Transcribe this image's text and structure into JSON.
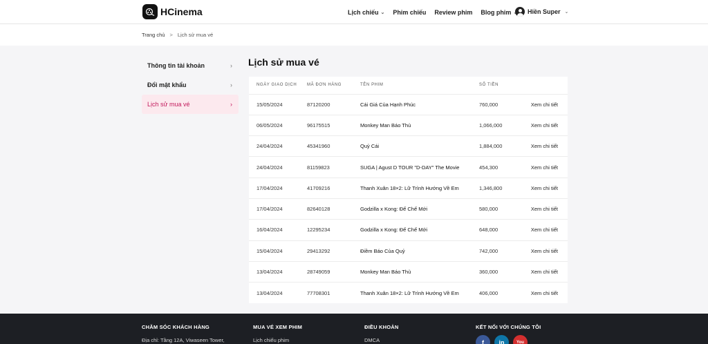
{
  "brand": {
    "name": "HCinema"
  },
  "nav": {
    "items": [
      {
        "label": "Lịch chiếu",
        "has_dropdown": true
      },
      {
        "label": "Phim chiếu",
        "has_dropdown": false
      },
      {
        "label": "Review phim",
        "has_dropdown": false
      },
      {
        "label": "Blog phim",
        "has_dropdown": true
      }
    ],
    "user_name": "Hiền Super"
  },
  "breadcrumb": {
    "home": "Trang chủ",
    "separator": ">",
    "current": "Lịch sử mua vé"
  },
  "sidebar": {
    "items": [
      {
        "label": "Thông tin tài khoản",
        "active": false
      },
      {
        "label": "Đổi mật khẩu",
        "active": false
      },
      {
        "label": "Lịch sử mua vé",
        "active": true
      }
    ]
  },
  "main": {
    "title": "Lịch sử mua vé",
    "columns": {
      "date": "NGÀY GIAO DỊCH",
      "order": "MÃ ĐƠN HÀNG",
      "film": "TÊN PHIM",
      "amount": "SỐ TIỀN"
    },
    "rows": [
      {
        "date": "15/05/2024",
        "order": "87120200",
        "film": "Cái Giá Của Hạnh Phúc",
        "amount": "760,000",
        "action": "Xem chi tiết"
      },
      {
        "date": "06/05/2024",
        "order": "96175515",
        "film": "Monkey Man Báo Thù",
        "amount": "1,066,000",
        "action": "Xem chi tiết"
      },
      {
        "date": "24/04/2024",
        "order": "45341960",
        "film": "Quỷ Cái",
        "amount": "1,884,000",
        "action": "Xem chi tiết"
      },
      {
        "date": "24/04/2024",
        "order": "81159823",
        "film": "SUGA | Agust D TOUR \"D-DAY\" The Movie",
        "amount": "454,300",
        "action": "Xem chi tiết"
      },
      {
        "date": "17/04/2024",
        "order": "41709216",
        "film": "Thanh Xuân 18×2: Lữ Trình Hướng Về Em",
        "amount": "1,346,800",
        "action": "Xem chi tiết"
      },
      {
        "date": "17/04/2024",
        "order": "82640128",
        "film": "Godzilla x Kong: Đế Chế Mới",
        "amount": "580,000",
        "action": "Xem chi tiết"
      },
      {
        "date": "16/04/2024",
        "order": "12295234",
        "film": "Godzilla x Kong: Đế Chế Mới",
        "amount": "648,000",
        "action": "Xem chi tiết"
      },
      {
        "date": "15/04/2024",
        "order": "29413292",
        "film": "Điềm Báo Của Quỷ",
        "amount": "742,000",
        "action": "Xem chi tiết"
      },
      {
        "date": "13/04/2024",
        "order": "28749059",
        "film": "Monkey Man Báo Thù",
        "amount": "360,000",
        "action": "Xem chi tiết"
      },
      {
        "date": "13/04/2024",
        "order": "77708301",
        "film": "Thanh Xuân 18×2: Lữ Trình Hướng Về Em",
        "amount": "406,000",
        "action": "Xem chi tiết"
      }
    ]
  },
  "footer": {
    "care": {
      "heading": "CHĂM SÓC KHÁCH HÀNG",
      "line": "Địa chỉ: Tầng 12A, Viwaseen Tower,"
    },
    "tickets": {
      "heading": "MUA VÉ XEM PHIM",
      "line": "Lịch chiếu phim"
    },
    "terms": {
      "heading": "ĐIỀU KHOẢN",
      "line": "DMCA"
    },
    "connect": {
      "heading": "KẾT NỐI VỚI CHÚNG TÔI",
      "socials": [
        {
          "icon": "facebook-icon",
          "glyph": "f",
          "color": "#3b5998"
        },
        {
          "icon": "linkedin-icon",
          "glyph": "in",
          "color": "#0e76a8"
        },
        {
          "icon": "youtube-icon",
          "glyph": "You",
          "color": "#d32f2f"
        }
      ]
    }
  }
}
